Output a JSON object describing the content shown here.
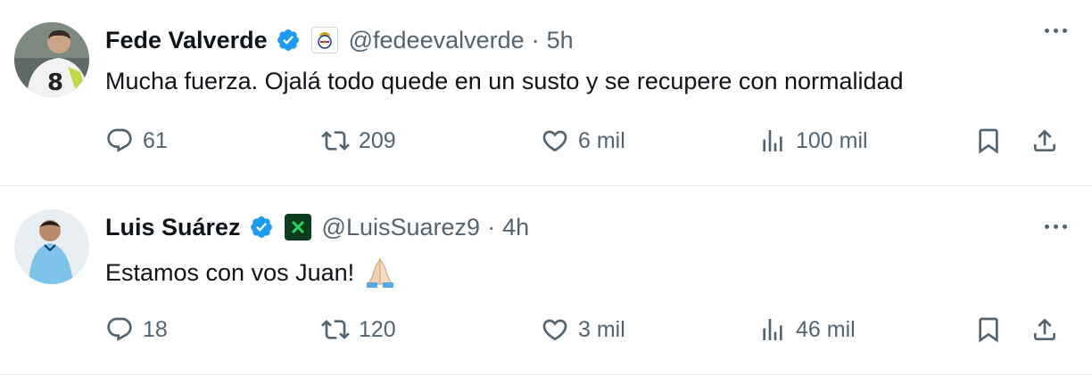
{
  "tweets": [
    {
      "name": "Fede Valverde",
      "handle": "@fedeevalverde",
      "separator": "·",
      "time": "5h",
      "text": "Mucha fuerza. Ojalá todo quede en un susto y se recupere con normalidad",
      "replies": "61",
      "retweets": "209",
      "likes": "6 mil",
      "views": "100 mil",
      "avatar_icon": "player-avatar-white-jersey-8",
      "affiliation_icon": "real-madrid-crest-icon"
    },
    {
      "name": "Luis Suárez",
      "handle": "@LuisSuarez9",
      "separator": "·",
      "time": "4h",
      "text": "Estamos con vos Juan!",
      "emoji": "folded-hands-emoji",
      "replies": "18",
      "retweets": "120",
      "likes": "3 mil",
      "views": "46 mil",
      "avatar_icon": "player-avatar-sky-blue-jersey",
      "affiliation_icon": "green-club-crest-icon"
    }
  ],
  "colors": {
    "text": "#0f1419",
    "secondary": "#536471",
    "verified": "#1d9bf0",
    "divider": "#e6e9eb"
  }
}
